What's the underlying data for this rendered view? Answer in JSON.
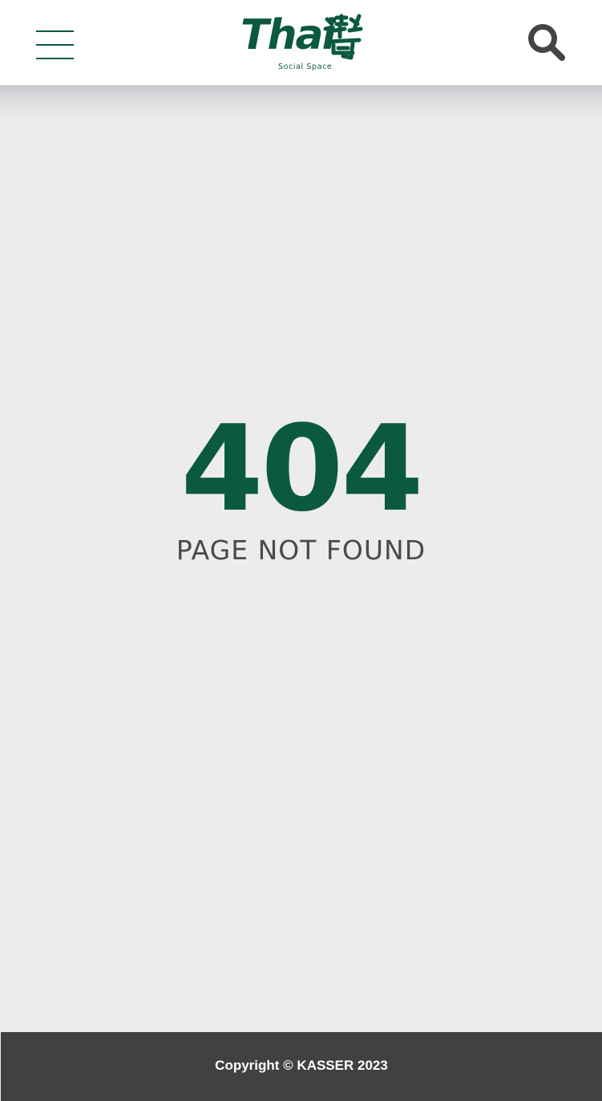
{
  "header": {
    "menu_icon": "hamburger-menu-icon",
    "logo": {
      "word": "Thai",
      "glyph": "灣",
      "tagline": "Social Space"
    },
    "search_icon": "search-icon"
  },
  "error": {
    "code": "404",
    "message": "PAGE NOT FOUND"
  },
  "footer": {
    "copyright": "Copyright © KASSER 2023"
  },
  "colors": {
    "brand": "#0b5a3e",
    "search_icon": "#444444",
    "background": "#ececec",
    "footer_bg": "#414141",
    "message_text": "#4a4a4a"
  }
}
